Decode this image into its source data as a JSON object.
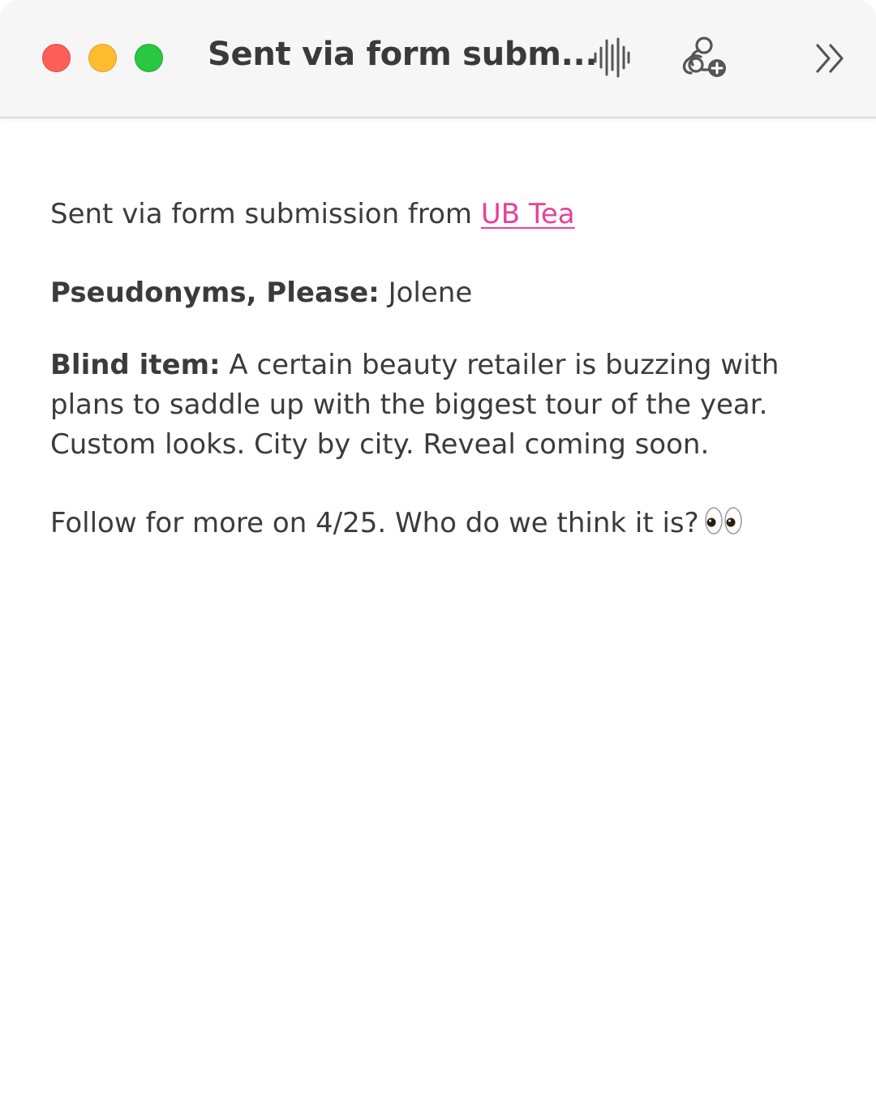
{
  "window": {
    "title": "Sent via form subm..."
  },
  "toolbar": {
    "icons": [
      "waveform-icon",
      "collaborate-icon",
      "chevrons-right-icon"
    ]
  },
  "note": {
    "intro_text": "Sent via form submission from ",
    "intro_link": "UB Tea",
    "pseudonym_label": "Pseudonyms, Please:",
    "pseudonym_value": "Jolene",
    "blind_item_label": "Blind item:",
    "blind_item_text": "A certain beauty retailer is buzzing with plans to saddle up with the biggest tour of the year. Custom looks. City by city. Reveal coming soon.",
    "closing_text": "Follow for more on 4/25. Who do we think it is?",
    "closing_emoji": "eyes-emoji"
  },
  "colors": {
    "link": "#e8409a",
    "close": "#ff5f57",
    "minimize": "#febc2e",
    "maximize": "#28c840"
  }
}
